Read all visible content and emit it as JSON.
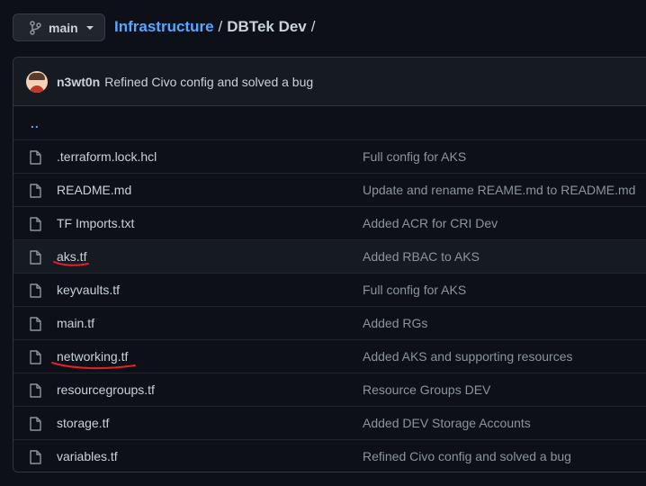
{
  "branch": {
    "label": "main",
    "icon": "git-branch-icon"
  },
  "breadcrumb": {
    "root": "Infrastructure",
    "separator": "/",
    "current": "DBTek Dev",
    "trailing": "/"
  },
  "commit": {
    "author": "n3wt0n",
    "message": "Refined Civo config and solved a bug"
  },
  "parent_dir": "..",
  "files": [
    {
      "name": ".terraform.lock.hcl",
      "message": "Full config for AKS"
    },
    {
      "name": "README.md",
      "message": "Update and rename REAME.md to README.md"
    },
    {
      "name": "TF Imports.txt",
      "message": "Added ACR for CRI Dev"
    },
    {
      "name": "aks.tf",
      "message": "Added RBAC to AKS"
    },
    {
      "name": "keyvaults.tf",
      "message": "Full config for AKS"
    },
    {
      "name": "main.tf",
      "message": "Added RGs"
    },
    {
      "name": "networking.tf",
      "message": "Added AKS and supporting resources"
    },
    {
      "name": "resourcegroups.tf",
      "message": "Resource Groups DEV"
    },
    {
      "name": "storage.tf",
      "message": "Added DEV Storage Accounts"
    },
    {
      "name": "variables.tf",
      "message": "Refined Civo config and solved a bug"
    }
  ],
  "colors": {
    "background": "#0d1117",
    "link": "#58a6ff",
    "text": "#c9d1d9",
    "muted": "#8b949e",
    "annotation": "#e5202b"
  }
}
